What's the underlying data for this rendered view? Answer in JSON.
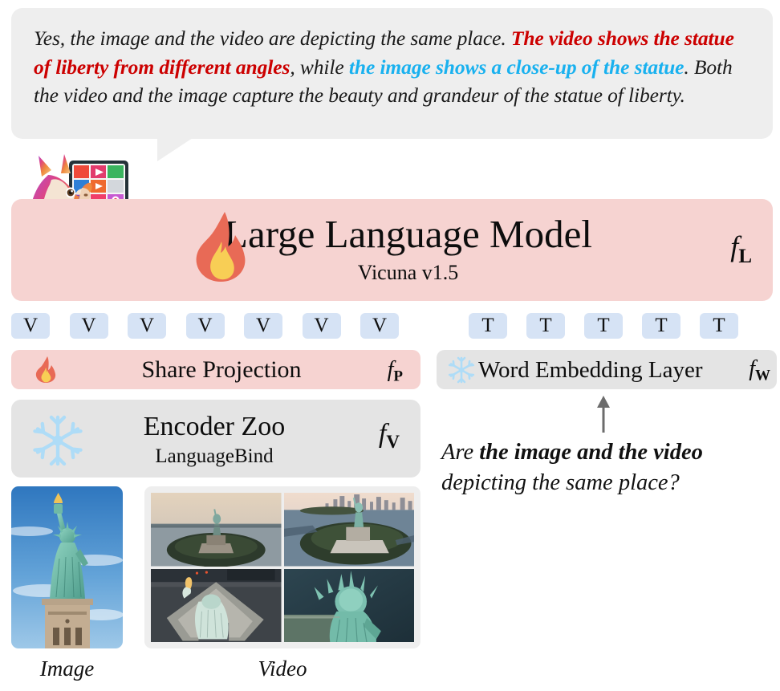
{
  "response_bubble": {
    "name": "model-response",
    "segments": [
      {
        "text": "Yes, the image and the video are depicting the same place. ",
        "style": "plain"
      },
      {
        "text": "The video shows the statue of liberty from different angles",
        "style": "red"
      },
      {
        "text": ", while ",
        "style": "plain"
      },
      {
        "text": "the image shows a close-up of the statue",
        "style": "cyan"
      },
      {
        "text": ". Both the video and the image capture the beauty and grandeur of the statue of liberty.",
        "style": "plain"
      }
    ]
  },
  "llm": {
    "title": "Large Language Model",
    "subtitle": "Vicuna v1.5",
    "function_symbol": "f",
    "function_subscript": "L",
    "state_icon": "flame-icon",
    "state": "trainable",
    "logo_icon": "llama-monitor-icon"
  },
  "tokens": {
    "visual": {
      "label": "V",
      "count": 7
    },
    "text": {
      "label": "T",
      "count": 5
    }
  },
  "share_projection": {
    "label": "Share Projection",
    "function_symbol": "f",
    "function_subscript": "P",
    "state_icon": "flame-icon",
    "state": "trainable"
  },
  "word_embedding": {
    "label": "Word Embedding Layer",
    "function_symbol": "f",
    "function_subscript": "W",
    "state_icon": "snowflake-icon",
    "state": "frozen"
  },
  "encoder_zoo": {
    "title": "Encoder Zoo",
    "subtitle": "LanguageBind",
    "function_symbol": "f",
    "function_subscript": "V",
    "state_icon": "snowflake-icon",
    "state": "frozen"
  },
  "prompt": {
    "arrow_icon": "up-arrow-icon",
    "segments": [
      {
        "text": "Are ",
        "style": "plain"
      },
      {
        "text": "the image and the video",
        "style": "bold"
      },
      {
        "text": " depicting the same place?",
        "style": "plain"
      }
    ]
  },
  "media": {
    "image_caption": "Image",
    "video_caption": "Video",
    "image_alt": "statue-of-liberty-closeup",
    "video_frames": [
      "aerial-liberty-island-dusk",
      "aerial-liberty-island-with-skyline",
      "overhead-statue-torch-view",
      "close-aerial-statue-crown-view"
    ]
  },
  "colors": {
    "trainable_bg": "#f6d3d1",
    "frozen_bg": "#e4e4e4",
    "token_bg": "#d6e3f5",
    "bubble_bg": "#eeeeee",
    "highlight_red": "#cc0000",
    "highlight_cyan": "#19b1ef",
    "flame_outer": "#e86a56",
    "flame_inner": "#f8ce55",
    "snowflake": "#aedcf7"
  }
}
